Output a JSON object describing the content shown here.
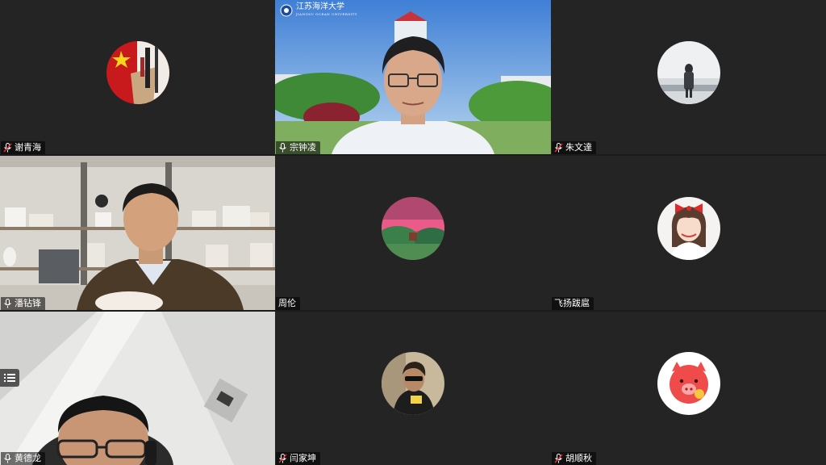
{
  "meeting": {
    "participants": [
      {
        "name": "谢青海",
        "mic": "muted",
        "video": false
      },
      {
        "name": "宗钟凌",
        "mic": "on",
        "video": true
      },
      {
        "name": "朱文達",
        "mic": "muted",
        "video": false
      },
      {
        "name": "潘钻锋",
        "mic": "on",
        "video": true,
        "active_speaker": true
      },
      {
        "name": "周伦",
        "mic": "none",
        "video": false
      },
      {
        "name": "飞扬跋扈",
        "mic": "none",
        "video": false
      },
      {
        "name": "黄德龙",
        "mic": "on",
        "video": true
      },
      {
        "name": "闫家坤",
        "mic": "muted",
        "video": false
      },
      {
        "name": "胡顺秋",
        "mic": "muted",
        "video": false
      }
    ],
    "virtual_background_text": "江苏海洋大学",
    "virtual_background_subtext": "JIANGSU OCEAN UNIVERSITY"
  },
  "colors": {
    "active_speaker_border": "#25c04a",
    "muted_mic": "#e0323b",
    "tile_bg": "#242424"
  },
  "icons": {
    "mic_on": "microphone-icon",
    "mic_muted": "microphone-muted-icon",
    "menu": "list-menu-icon"
  }
}
